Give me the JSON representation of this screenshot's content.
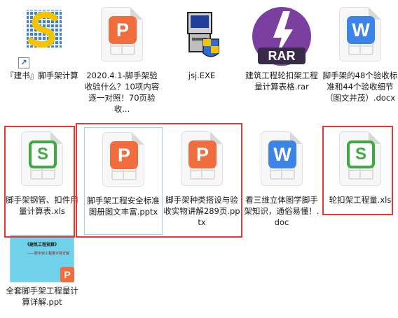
{
  "files": [
    {
      "label": "『建书』脚手架计算",
      "type": "shortcut",
      "icon": "app-s-icon"
    },
    {
      "label": "2020.4.1-脚手架验收验什么？10项内容逐一对照！70页验收...",
      "type": "ppt",
      "badge": "P"
    },
    {
      "label": "jsj.EXE",
      "type": "exe",
      "icon": "installer-icon"
    },
    {
      "label": "建筑工程轮扣架工程量计算表格.rar",
      "type": "rar",
      "badge": "RAR"
    },
    {
      "label": "脚手架的48个验收标准和44个验收细节（图文并茂）.docx",
      "type": "doc",
      "badge": "W"
    },
    {
      "label": "脚手架钢管、扣件用量计算表.xls",
      "type": "xls",
      "badge": "S"
    },
    {
      "label": "脚手架工程安全标准图册图文丰富.pptx",
      "type": "ppt",
      "badge": "P"
    },
    {
      "label": "脚手架种类搭设与验收实物讲解289页.pptx",
      "type": "ppt",
      "badge": "P"
    },
    {
      "label": "看三维立体图学脚手架知识，通俗易懂！.doc",
      "type": "doc",
      "badge": "W"
    },
    {
      "label": "轮扣架工程量.xls",
      "type": "xls",
      "badge": "S"
    },
    {
      "label": "全套脚手架工程量计算详解.ppt",
      "type": "ppt-thumb",
      "badge": "P",
      "thumb_title": "《建筑工程预算》",
      "thumb_subtitle": "——脚手架工程量计算详解"
    }
  ],
  "colors": {
    "highlight_box": "#e53935",
    "selection_border": "#99d1ff",
    "ppt": "#f26d3d",
    "xls": "#3dab3f",
    "doc": "#3c84e8",
    "rar": "#7b3fa0"
  }
}
